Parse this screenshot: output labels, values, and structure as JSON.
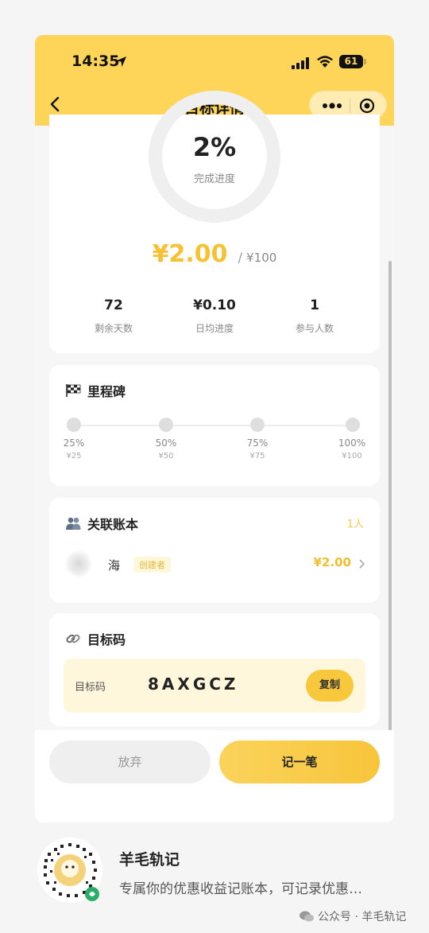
{
  "status_bar": {
    "time": "14:35",
    "battery": "61"
  },
  "nav": {
    "title": "目标详情"
  },
  "progress_card": {
    "percent": "2%",
    "percent_label": "完成进度",
    "saved_amount": "¥2.00",
    "separator": "/",
    "target_amount": "¥100",
    "stats": [
      {
        "value": "72",
        "label": "剩余天数"
      },
      {
        "value": "¥0.10",
        "label": "日均进度"
      },
      {
        "value": "1",
        "label": "参与人数"
      }
    ]
  },
  "milestones": {
    "title": "里程碑",
    "items": [
      {
        "percent": "25%",
        "amount": "¥25"
      },
      {
        "percent": "50%",
        "amount": "¥50"
      },
      {
        "percent": "75%",
        "amount": "¥75"
      },
      {
        "percent": "100%",
        "amount": "¥100"
      }
    ]
  },
  "linked_book": {
    "title": "关联账本",
    "count": "1人",
    "member": {
      "name": "海",
      "tag": "创建者",
      "amount": "¥2.00"
    }
  },
  "goal_code": {
    "title": "目标码",
    "label": "目标码",
    "code": "8AXGCZ",
    "copy_label": "复制"
  },
  "actions": {
    "abandon_label": "放弃",
    "record_label": "记一笔"
  },
  "footer": {
    "name": "羊毛轨记",
    "description": "专属你的优惠收益记账本，可记录优惠…",
    "source": "公众号 · 羊毛轨记"
  },
  "colors": {
    "brand_yellow": "#fed558",
    "accent_amount": "#f7c133",
    "button_yellow": "#f8c83c"
  }
}
